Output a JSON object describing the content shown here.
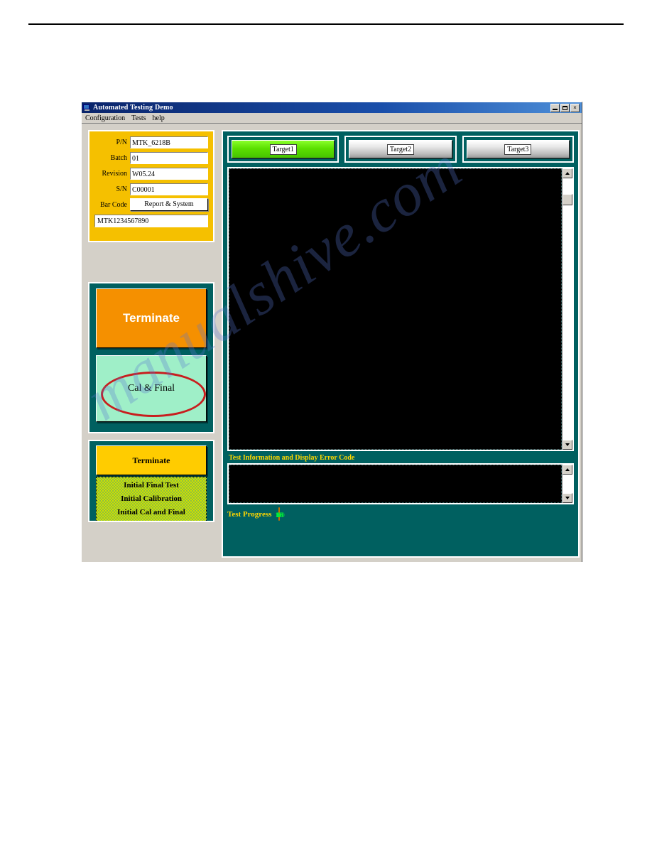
{
  "window": {
    "title": "Automated Testing Demo",
    "icon": "application-icon",
    "buttons": {
      "minimize": "minimize",
      "maximize": "maximize",
      "close": "×"
    }
  },
  "menu": {
    "items": [
      "Configuration",
      "Tests",
      "help"
    ]
  },
  "info_panel": {
    "fields": [
      {
        "label": "P/N",
        "value": "MTK_6218B"
      },
      {
        "label": "Batch",
        "value": "01"
      },
      {
        "label": "Revision",
        "value": "W05.24"
      },
      {
        "label": "S/N",
        "value": "C00001"
      }
    ],
    "barcode_label": "Bar Code",
    "report_button": "Report & System",
    "barcode_value": "MTK1234567890"
  },
  "actions": {
    "terminate_orange": "Terminate",
    "cal_final": "Cal & Final",
    "terminate_yellow": "Terminate",
    "test_list": [
      "Initial Final Test",
      "Initial Calibration",
      "Initial Cal and Final"
    ]
  },
  "targets": [
    {
      "label": "Target1",
      "state": "active"
    },
    {
      "label": "Target2",
      "state": "inactive"
    },
    {
      "label": "Target3",
      "state": "inactive"
    }
  ],
  "display": {
    "main_content": "",
    "info_label": "Test Information and Display Error Code",
    "log_content": ""
  },
  "progress": {
    "label": "Test Progress",
    "value": 100,
    "ticks": [
      0,
      5,
      10,
      15,
      20,
      25,
      30,
      35,
      40,
      45,
      50,
      55,
      60,
      65,
      70,
      75,
      80,
      85,
      90,
      95,
      100
    ]
  },
  "watermark": {
    "text": "manualshive.com"
  },
  "colors": {
    "teal_panel": "#006060",
    "yellow_panel": "#f5c000",
    "orange_button": "#f59000",
    "mint_button": "#9fefc8",
    "yellow_button": "#ffcc00",
    "green_active": "#5ce000",
    "annotation_red": "#c81e1e",
    "progress_fill": "#dcf000",
    "tick_green": "#00ee3a",
    "label_yellow": "#ffd700",
    "titlebar_blue": "#0a246a"
  }
}
